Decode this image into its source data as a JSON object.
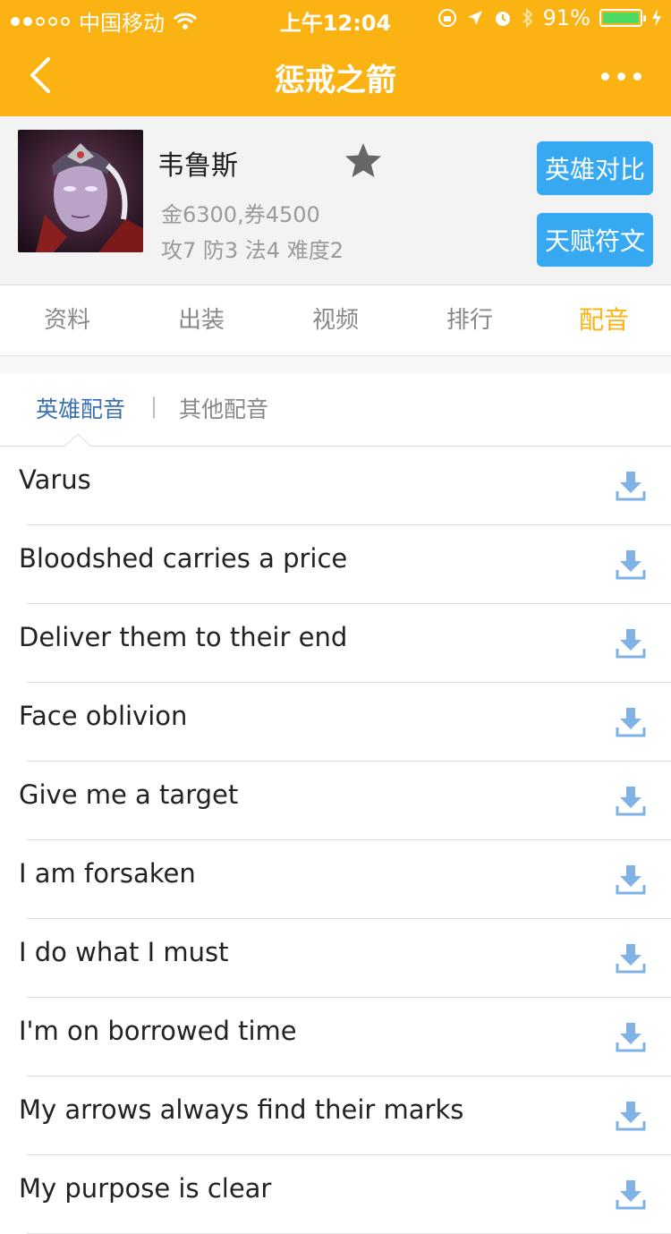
{
  "status_bar": {
    "carrier": "中国移动",
    "time": "上午12:04",
    "battery": "91%",
    "battery_level": 0.91
  },
  "nav": {
    "title": "惩戒之箭",
    "back_icon": "chevron-left-icon",
    "more_icon": "more-dots-icon"
  },
  "hero": {
    "name": "韦鲁斯",
    "price": "金6300,券4500",
    "stats": "攻7 防3 法4 难度2",
    "compare_button": "英雄对比",
    "runes_button": "天赋符文"
  },
  "tabs": [
    {
      "label": "资料"
    },
    {
      "label": "出装"
    },
    {
      "label": "视频"
    },
    {
      "label": "排行"
    },
    {
      "label": "配音",
      "active": true
    }
  ],
  "subtabs": {
    "hero_voice": "英雄配音",
    "separator": "|",
    "other_voice": "其他配音"
  },
  "voice_lines": [
    "Varus",
    "Bloodshed carries a price",
    "Deliver them to their end",
    "Face oblivion",
    "Give me a target",
    "I am forsaken",
    "I do what I must",
    "I'm on borrowed time",
    "My arrows always find their marks",
    "My purpose is clear"
  ],
  "colors": {
    "brand": "#fbb313",
    "button": "#37a9f2",
    "subtab_active": "#3b6fb6",
    "download_icon": "#7fb2e5"
  }
}
